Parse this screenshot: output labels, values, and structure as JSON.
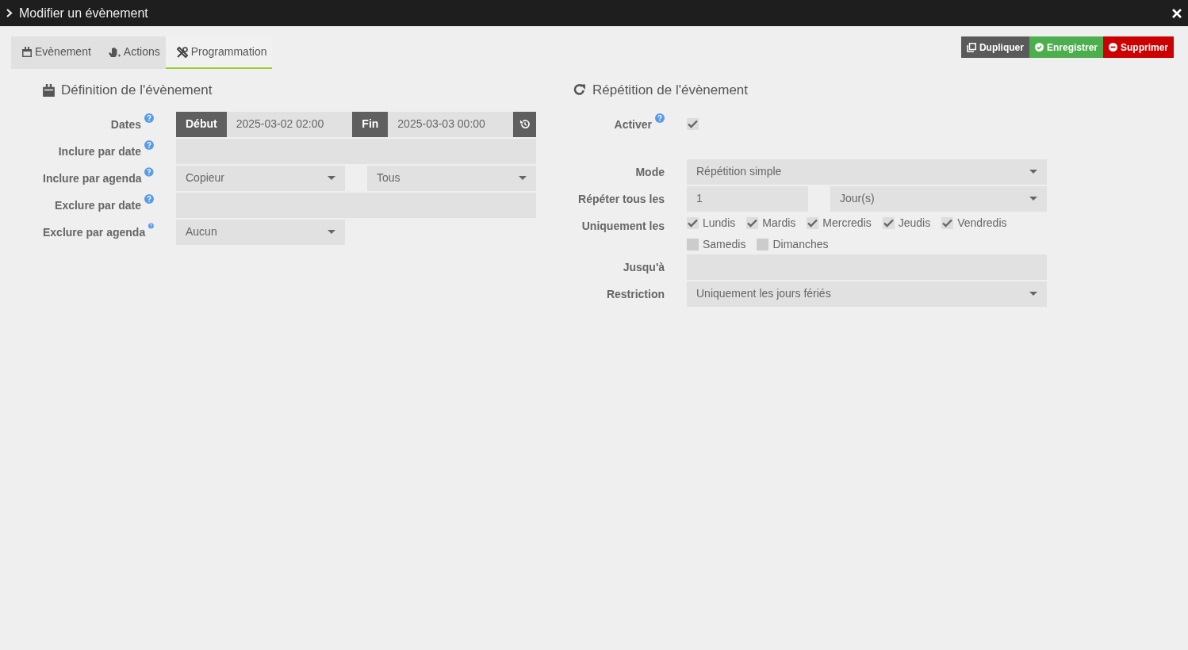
{
  "window": {
    "title": "Modifier un évènement"
  },
  "tabs": [
    {
      "label": "Evènement",
      "selected": false
    },
    {
      "label": "Actions",
      "selected": false
    },
    {
      "label": "Programmation",
      "selected": true
    }
  ],
  "buttons": [
    {
      "label": "Dupliquer",
      "kind": "duplicate"
    },
    {
      "label": "Enregistrer",
      "kind": "save"
    },
    {
      "label": "Supprimer",
      "kind": "delete"
    }
  ],
  "definition": {
    "title": "Définition de l'évènement",
    "fields": [
      {
        "kind": "daterange",
        "label": "Dates",
        "help": true,
        "start_label": "Début",
        "start_value": "2025-03-02 02:00",
        "end_label": "Fin",
        "end_value": "2025-03-03 00:00"
      },
      {
        "kind": "input",
        "label": "Inclure par date",
        "help": true
      },
      {
        "kind": "select_pair",
        "label": "Inclure par agenda",
        "help": true,
        "value": "Copieur",
        "value_2": "Tous"
      },
      {
        "kind": "input",
        "label": "Exclure par date",
        "help": true
      },
      {
        "kind": "select_half",
        "label": "Exclure par agenda",
        "help": true,
        "value": "Aucun"
      }
    ]
  },
  "repetition": {
    "title": "Répétition de l'évènement",
    "fields": [
      {
        "kind": "checkbox",
        "label": "Activer",
        "help": true,
        "checked": true
      },
      {
        "kind": "select",
        "label": "Mode",
        "help": false,
        "value": "Répétition simple"
      },
      {
        "kind": "input_select",
        "label": "Répéter tous les",
        "help": false,
        "value": "1",
        "value_2": "Jour(s)"
      },
      {
        "kind": "days",
        "label": "Uniquement les",
        "help": false,
        "days": [
          {
            "label": "Lundis",
            "checked": true
          },
          {
            "label": "Mardis",
            "checked": true
          },
          {
            "label": "Mercredis",
            "checked": true
          },
          {
            "label": "Jeudis",
            "checked": true
          },
          {
            "label": "Vendredis",
            "checked": true
          },
          {
            "label": "Samedis",
            "checked": false
          },
          {
            "label": "Dimanches",
            "checked": false
          }
        ]
      },
      {
        "kind": "input",
        "label": "Jusqu'à",
        "help": false
      },
      {
        "kind": "select",
        "label": "Restriction",
        "help": false,
        "value": "Uniquement les jours fériés"
      }
    ]
  }
}
